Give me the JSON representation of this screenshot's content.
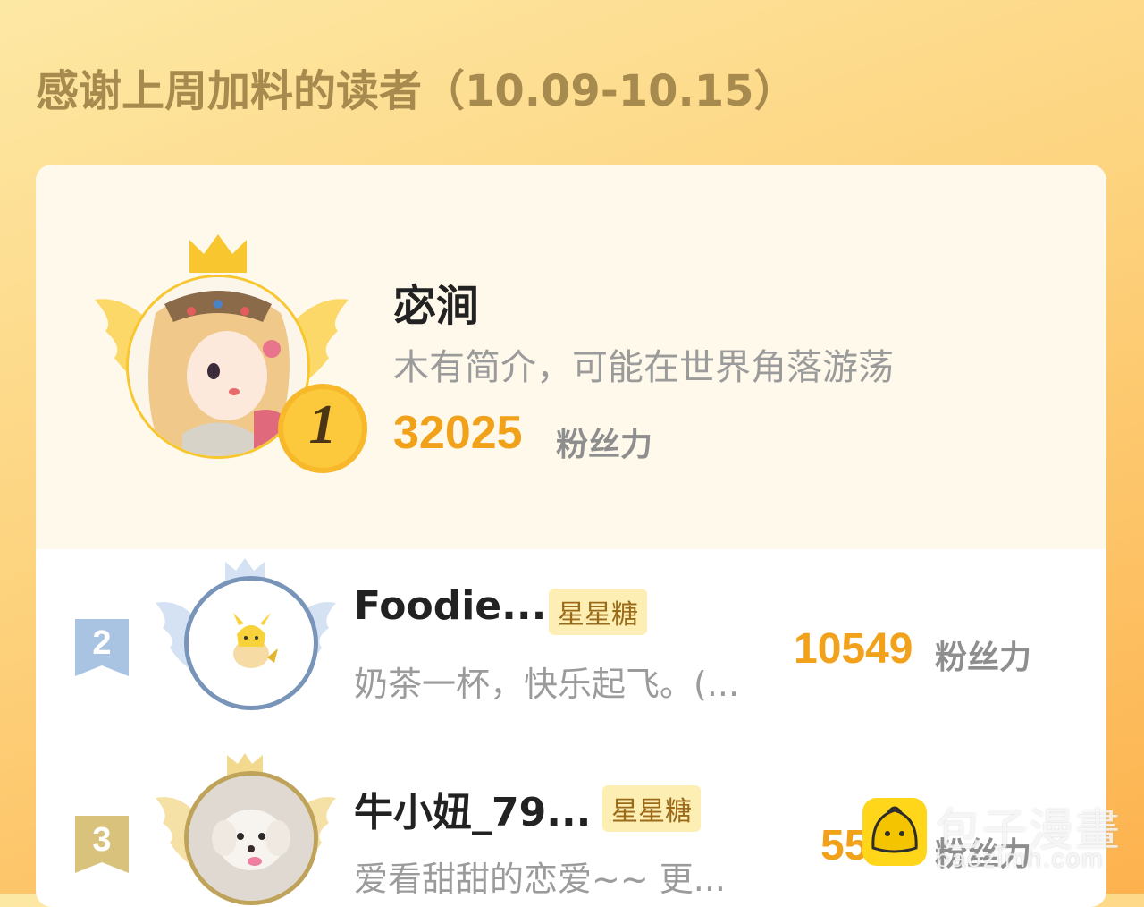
{
  "header": {
    "title": "感谢上周加料的读者（10.09-10.15）"
  },
  "colors": {
    "accent": "#f2a21a",
    "gold": "#f6c338",
    "silver": "#7894b8",
    "bronze": "#bfa35a"
  },
  "first": {
    "rank": "1",
    "name": "宓涧",
    "bio": "木有简介，可能在世界角落游荡",
    "score": "32025",
    "unit": "粉丝力"
  },
  "others": [
    {
      "rank": "2",
      "name": "Foodie...",
      "tag": "星星糖",
      "bio": "奶茶一杯，快乐起飞。(...",
      "score": "10549",
      "unit": "粉丝力"
    },
    {
      "rank": "3",
      "name": "牛小妞_79...",
      "tag": "星星糖",
      "bio": "爱看甜甜的恋爱~~ 更...",
      "score": "55",
      "unit": "粉丝力"
    }
  ],
  "watermark": {
    "brand": "包子漫畫",
    "url": "baozimh.com",
    "logo_icon": "bun-icon"
  }
}
